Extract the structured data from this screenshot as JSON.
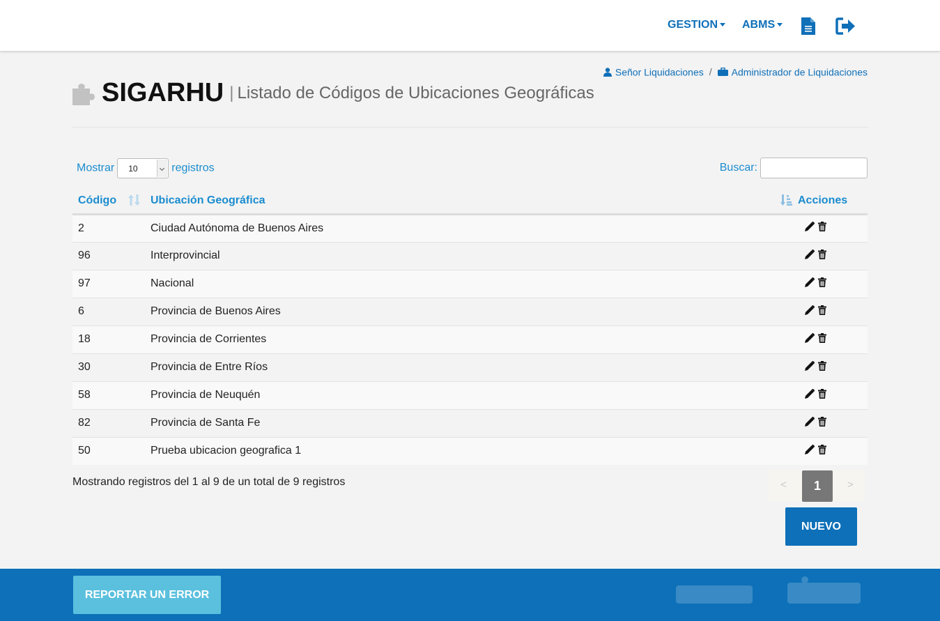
{
  "nav": {
    "gestion_label": "GESTION",
    "abms_label": "ABMS",
    "document_icon": "file-text-icon",
    "logout_icon": "sign-out-icon"
  },
  "breadcrumb": {
    "user_label": "Señor Liquidaciones",
    "separator": "/",
    "role_label": "Administrador de Liquidaciones"
  },
  "header": {
    "app_title": "SIGARHU",
    "separator": "|",
    "page_title": "Listado de Códigos de Ubicaciones Geográficas"
  },
  "controls": {
    "show_label": "Mostrar",
    "page_size": "10",
    "records_label": "registros",
    "search_label": "Buscar:",
    "search_value": ""
  },
  "table": {
    "headers": {
      "codigo": "Código",
      "ubicacion": "Ubicación Geográfica",
      "acciones": "Acciones"
    },
    "rows": [
      {
        "codigo": "2",
        "ubicacion": "Ciudad Autónoma de Buenos Aires"
      },
      {
        "codigo": "96",
        "ubicacion": "Interprovincial"
      },
      {
        "codigo": "97",
        "ubicacion": "Nacional"
      },
      {
        "codigo": "6",
        "ubicacion": "Provincia de Buenos Aires"
      },
      {
        "codigo": "18",
        "ubicacion": "Provincia de Corrientes"
      },
      {
        "codigo": "30",
        "ubicacion": "Provincia de Entre Ríos"
      },
      {
        "codigo": "58",
        "ubicacion": "Provincia de Neuquén"
      },
      {
        "codigo": "82",
        "ubicacion": "Provincia de Santa Fe"
      },
      {
        "codigo": "50",
        "ubicacion": "Prueba ubicacion geografica 1"
      }
    ]
  },
  "info_text": "Mostrando registros del 1 al 9 de un total de 9 registros",
  "pagination": {
    "prev": "<",
    "current": "1",
    "next": ">"
  },
  "buttons": {
    "nuevo": "NUEVO",
    "report": "REPORTAR UN ERROR"
  },
  "colors": {
    "brand_blue": "#0d70b8",
    "link_blue": "#1a8ccf",
    "report_button": "#5bc0de"
  }
}
